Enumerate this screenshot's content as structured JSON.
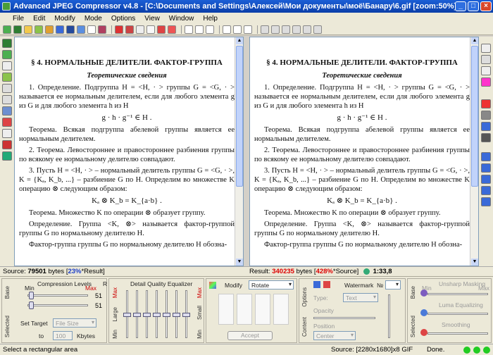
{
  "window": {
    "title": "Advanced JPEG Compressor v4.8 - [C:\\Documents and Settings\\Алексей\\Мои документы\\моё\\Банару\\6.gif  [zoom:50%]]"
  },
  "menu": [
    "File",
    "Edit",
    "Modify",
    "Mode",
    "Options",
    "View",
    "Window",
    "Help"
  ],
  "document": {
    "heading": "§ 4. НОРМАЛЬНЫЕ ДЕЛИТЕЛИ. ФАКТОР-ГРУППА",
    "subheading": "Теоретические сведения",
    "p1": "1. Определение. Подгруппа H = <H, · > группы G = <G, · > называется ее нормальным делителем, если для любого элемента g из G и для любого элемента h из H",
    "f1": "g · h · g⁻¹ ∈ H .",
    "p2": "Теорема. Всякая подгруппа абелевой группы является ее нормальным делителем.",
    "p3": "2. Теорема. Левостороннее и правостороннее разбиения группы по всякому ее нормальному делителю совпадают.",
    "p4": "3. Пусть H = <H, · > – нормальный делитель группы G = <G, · >, K = {Kₐ, K_b, ...} – разбиение G по H. Определим во множестве K операцию ⊗ следующим образом:",
    "f2": "Kₐ ⊗ K_b = K_{a·b} .",
    "p5": "Теорема. Множество K по операции ⊗ образует группу.",
    "p6": "Определение. Группа <K, ⊗> называется фактор-группой группы G по нормальному делителю H.",
    "p7": "Фактор-группа группы G по нормальному делителю H обозна-"
  },
  "status_left": {
    "label": "Source:",
    "bytes": "79501",
    "unit": "bytes",
    "pct": "23%",
    "suffix": "*Result]",
    "open": "["
  },
  "status_right": {
    "label": "Result:",
    "bytes": "340235",
    "unit": "bytes",
    "pct": "428%",
    "suffix": "*Source]",
    "open": "[",
    "ratio": "1:33,8"
  },
  "compression": {
    "side_tabs": [
      "Base",
      "Selected"
    ],
    "title": "Compression Levels",
    "min": "Min",
    "max": "Max",
    "r": "R",
    "value1": "51",
    "value2": "51",
    "set_target": "Set Target",
    "target_mode": "File Size",
    "to": "to",
    "target_value": "100",
    "target_unit": "Kbytes"
  },
  "equalizer": {
    "title": "Detail Quality Equalizer",
    "max": "Max",
    "min": "Min",
    "large": "Large",
    "small": "Small"
  },
  "modify": {
    "title": "Modify",
    "select": "Rotate",
    "accept": "Accept"
  },
  "watermark": {
    "side_tabs": [
      "Options",
      "Content"
    ],
    "title": "Watermark",
    "number_label": "№",
    "type_label": "Type:",
    "type_value": "Text",
    "opacity_label": "Opacity",
    "position_label": "Position",
    "position_value": "Center"
  },
  "unsharp": {
    "side_tabs": [
      "Base",
      "Selected"
    ],
    "unsharp": "Unsharp Masking",
    "luma": "Luma Equalizing",
    "smoothing": "Smoothing",
    "max": "Max",
    "min": "Min"
  },
  "statusbar": {
    "hint": "Select a rectangular area",
    "source_info": "Source: [2280x1680]x8 GIF",
    "done": "Done."
  },
  "colors": {
    "title_bar": "#1c5fd6",
    "red_value": "#dd0000",
    "blue_value": "#1a3cc8"
  }
}
